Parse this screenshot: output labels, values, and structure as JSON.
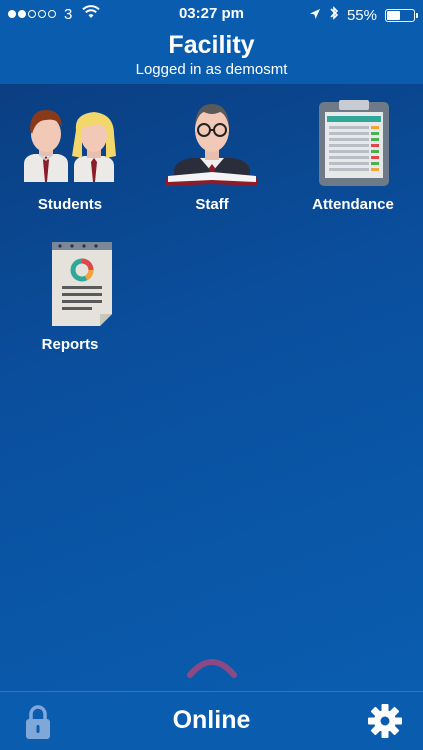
{
  "status_bar": {
    "carrier": "3",
    "time": "03:27 pm",
    "battery": "55%",
    "signal_bars_filled": 2,
    "signal_bars_total": 5,
    "battery_level": 0.55
  },
  "header": {
    "title": "Facility",
    "subtitle": "Logged in as demosmt"
  },
  "tiles": [
    {
      "label": "Students",
      "icon": "students-icon"
    },
    {
      "label": "Staff",
      "icon": "staff-icon"
    },
    {
      "label": "Attendance",
      "icon": "attendance-icon"
    },
    {
      "label": "Reports",
      "icon": "reports-icon"
    }
  ],
  "bottom_bar": {
    "status": "Online",
    "left_icon": "lock-icon",
    "right_icon": "gear-icon"
  },
  "colors": {
    "bar": "#0a5cae",
    "background": "#0a4f9e",
    "chevron": "#8c4a85"
  }
}
